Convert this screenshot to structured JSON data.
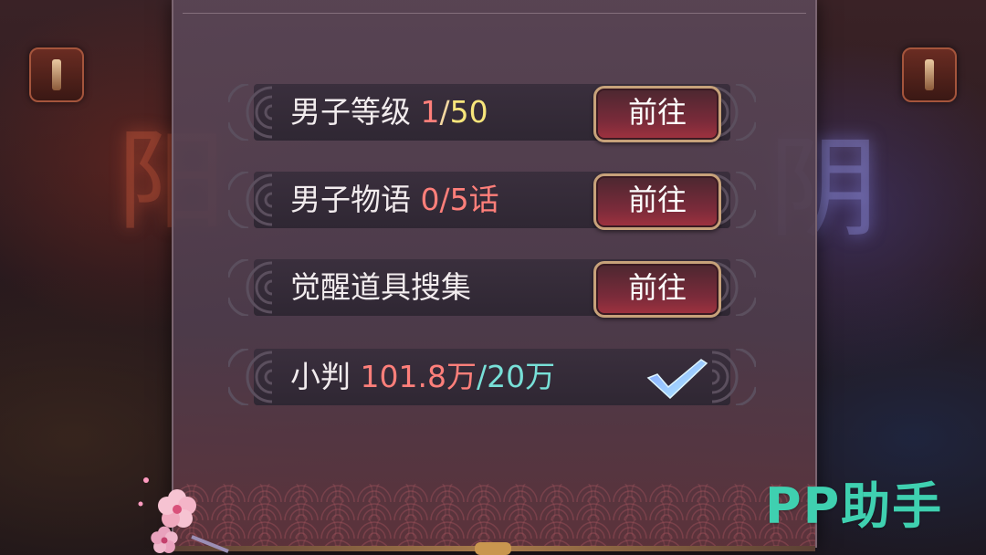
{
  "background": {
    "left_glyph": "阳",
    "right_glyph": "阴"
  },
  "tasks": [
    {
      "name": "男子等级",
      "current": "1",
      "slash": "/",
      "total": "50",
      "action": "前往"
    },
    {
      "name": "男子物语",
      "current": "0",
      "slash": "/",
      "total": "5话",
      "action": "前往"
    },
    {
      "name": "觉醒道具搜集",
      "action": "前往"
    },
    {
      "name": "小判",
      "current": "101.8万",
      "slash": "/",
      "total": "20万",
      "status": "completed"
    }
  ],
  "watermark": "PP助手",
  "colors": {
    "current": "#ff7f7a",
    "level_total": "#f7e57b",
    "done": "#78e0d8",
    "button_border": "#c7a27a",
    "watermark": "#3fd0b0"
  },
  "icons": {
    "completed": "checkmark-icon",
    "decoration": "sakura-icon"
  }
}
